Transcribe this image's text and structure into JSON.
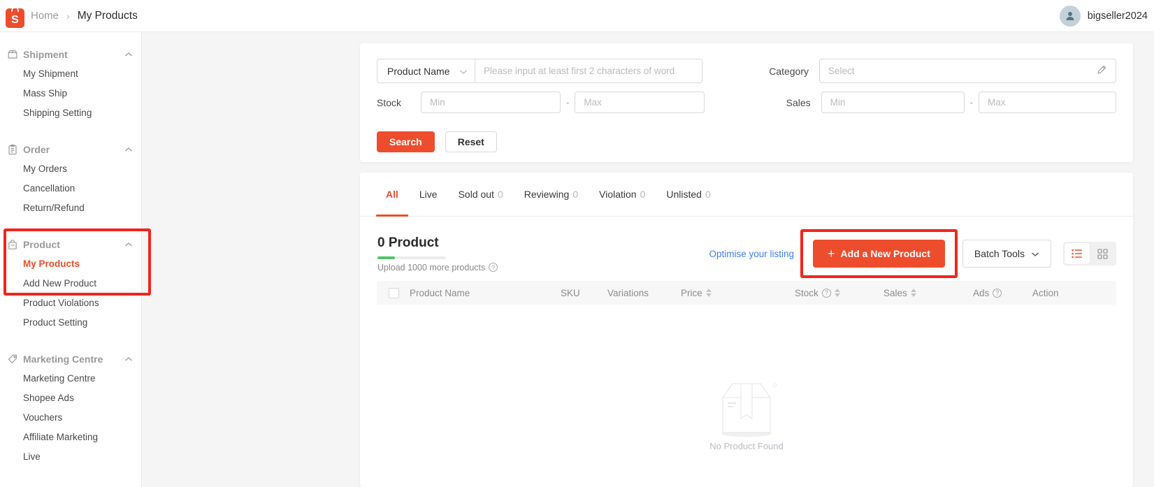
{
  "colors": {
    "accent": "#ee4d2d",
    "annotation_red": "#f0261c",
    "link_blue": "#3d7eff",
    "progress_green": "#53c268"
  },
  "header": {
    "breadcrumb": {
      "home": "Home",
      "separator": "›",
      "current": "My Products"
    },
    "username": "bigseller2024"
  },
  "sidebar": {
    "sections": [
      {
        "label": "Shipment",
        "icon": "package-icon",
        "items": [
          "My Shipment",
          "Mass Ship",
          "Shipping Setting"
        ]
      },
      {
        "label": "Order",
        "icon": "order-icon",
        "items": [
          "My Orders",
          "Cancellation",
          "Return/Refund"
        ]
      },
      {
        "label": "Product",
        "icon": "product-bag-icon",
        "items": [
          "My Products",
          "Add New Product",
          "Product Violations",
          "Product Setting"
        ],
        "active_item": "My Products"
      },
      {
        "label": "Marketing Centre",
        "icon": "tag-icon",
        "items": [
          "Marketing Centre",
          "Shopee Ads",
          "Vouchers",
          "Affiliate Marketing",
          "Live"
        ]
      }
    ]
  },
  "filters": {
    "search_type": "Product Name",
    "search_placeholder": "Please input at least first 2 characters of word",
    "category_label": "Category",
    "category_placeholder": "Select",
    "stock_label": "Stock",
    "sales_label": "Sales",
    "min_placeholder": "Min",
    "max_placeholder": "Max",
    "range_separator": "-",
    "search_button": "Search",
    "reset_button": "Reset"
  },
  "tabs": [
    {
      "label": "All",
      "count": ""
    },
    {
      "label": "Live",
      "count": ""
    },
    {
      "label": "Sold out",
      "count": "0"
    },
    {
      "label": "Reviewing",
      "count": "0"
    },
    {
      "label": "Violation",
      "count": "0"
    },
    {
      "label": "Unlisted",
      "count": "0"
    }
  ],
  "toolbar": {
    "product_count": "0 Product",
    "upload_quota_text": "Upload 1000 more products",
    "upload_progress_percent": 25,
    "optimise_link": "Optimise your listing",
    "plus": "+",
    "add_button": "Add a New Product",
    "batch_tools": "Batch Tools",
    "help_symbol": "?"
  },
  "table": {
    "columns": [
      {
        "label": "Product Name"
      },
      {
        "label": "SKU"
      },
      {
        "label": "Variations"
      },
      {
        "label": "Price",
        "sortable": true
      },
      {
        "label": "Stock",
        "help": true,
        "sortable": true
      },
      {
        "label": "Sales",
        "sortable": true
      },
      {
        "label": "Ads",
        "help": true
      },
      {
        "label": "Action"
      }
    ],
    "help_symbol": "?",
    "empty_text": "No Product Found"
  }
}
